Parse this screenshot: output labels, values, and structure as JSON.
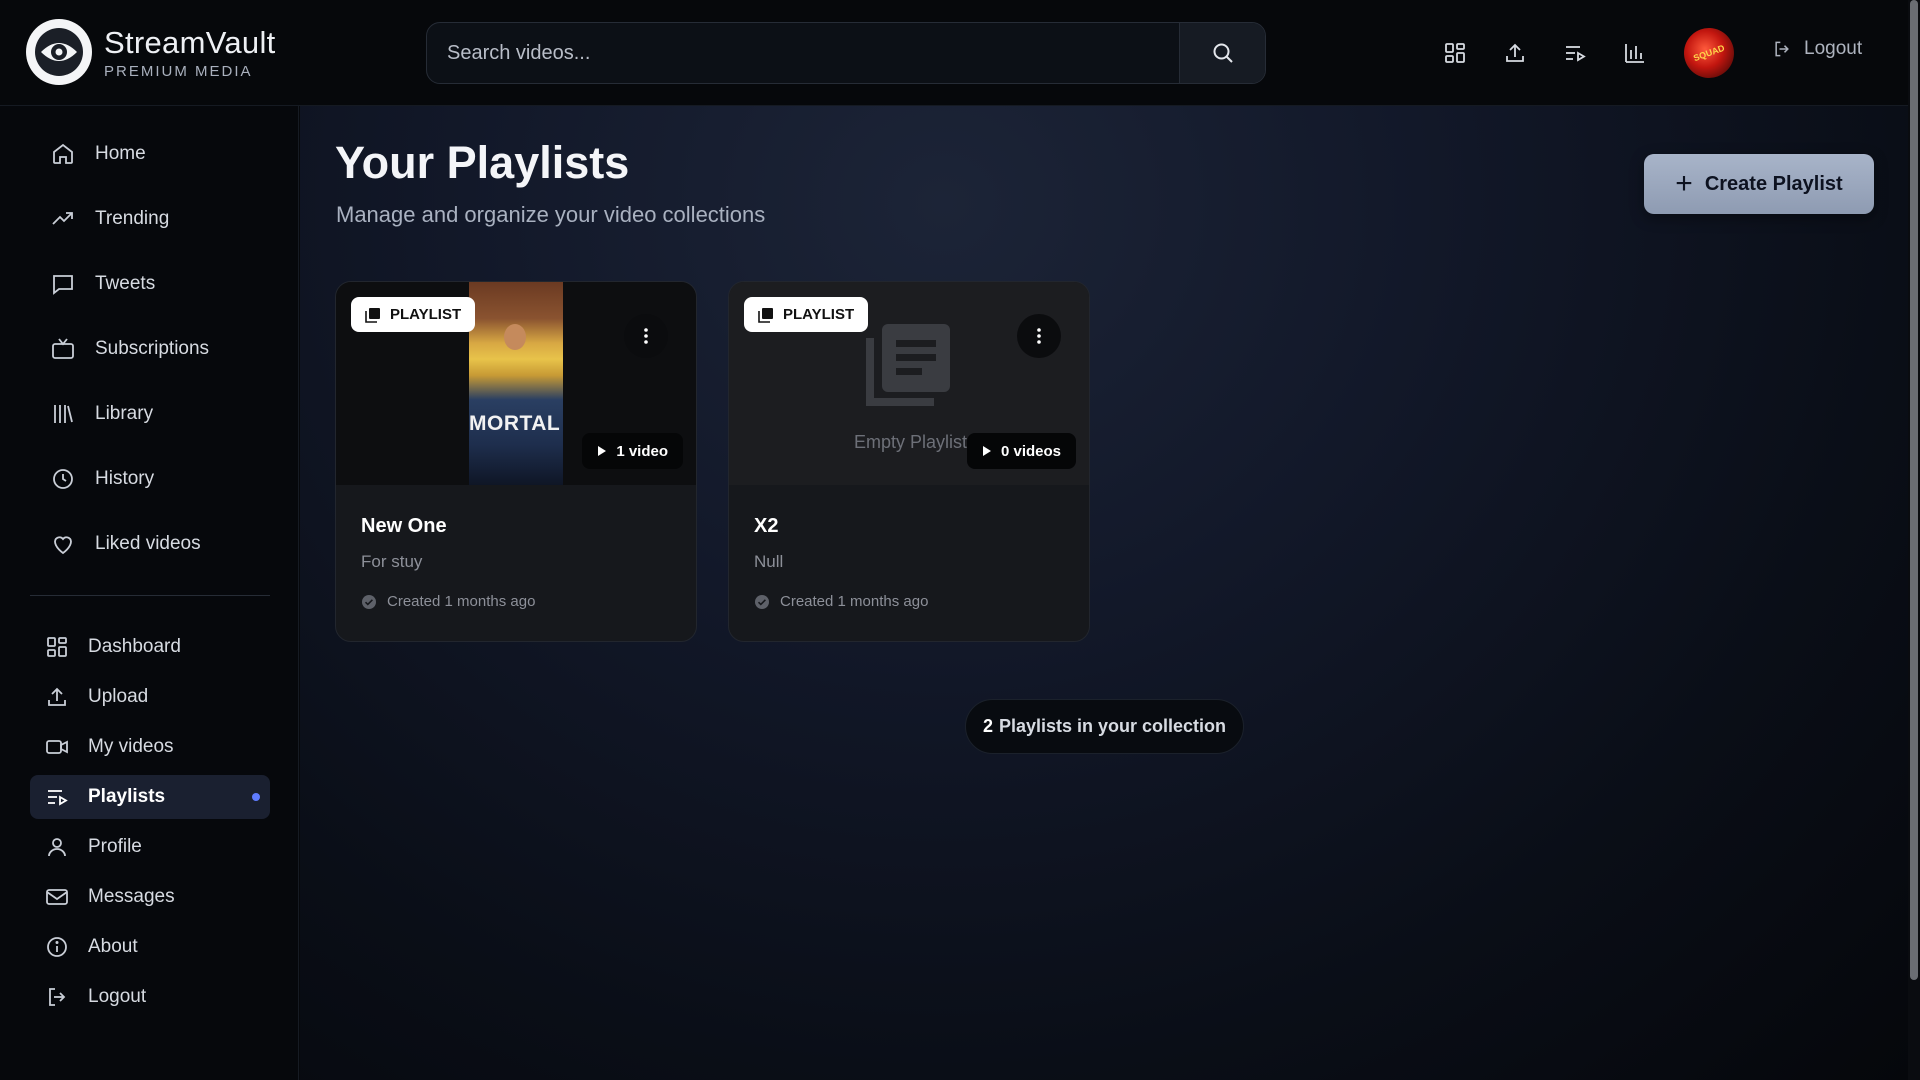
{
  "header": {
    "logo_name": "StreamVault",
    "logo_sub": "PREMIUM MEDIA",
    "search_placeholder": "Search videos...",
    "logout_label": "Logout",
    "avatar_text": "SQUAD"
  },
  "sidebar": {
    "primary": [
      {
        "label": "Home",
        "icon": "home-icon"
      },
      {
        "label": "Trending",
        "icon": "trending-icon"
      },
      {
        "label": "Tweets",
        "icon": "tweet-icon"
      },
      {
        "label": "Subscriptions",
        "icon": "tv-icon"
      },
      {
        "label": "Library",
        "icon": "library-icon"
      },
      {
        "label": "History",
        "icon": "clock-icon"
      },
      {
        "label": "Liked videos",
        "icon": "heart-icon"
      }
    ],
    "secondary": [
      {
        "label": "Dashboard",
        "icon": "dashboard-icon"
      },
      {
        "label": "Upload",
        "icon": "upload-icon"
      },
      {
        "label": "My videos",
        "icon": "video-icon"
      },
      {
        "label": "Playlists",
        "icon": "playlist-icon",
        "active": true
      },
      {
        "label": "Profile",
        "icon": "user-icon"
      },
      {
        "label": "Messages",
        "icon": "mail-icon"
      },
      {
        "label": "About",
        "icon": "info-icon"
      },
      {
        "label": "Logout",
        "icon": "logout-icon"
      }
    ]
  },
  "main": {
    "title": "Your Playlists",
    "subtitle": "Manage and organize your video collections",
    "create_label": "Create Playlist",
    "cards": [
      {
        "badge": "PLAYLIST",
        "count": "1 video",
        "title": "New One",
        "description": "For stuy",
        "meta": "Created 1 months ago",
        "thumb_text": "MORTAL"
      },
      {
        "badge": "PLAYLIST",
        "count": "0 videos",
        "title": "X2",
        "description": "Null",
        "meta": "Created 1 months ago",
        "empty_label": "Empty Playlist"
      }
    ],
    "summary_count": "2",
    "summary_text": "Playlists in your collection"
  },
  "colors": {
    "accent_dot": "#5f7cff",
    "create_button": "#a8b4c9",
    "active_nav_bg": "#1a2030"
  }
}
